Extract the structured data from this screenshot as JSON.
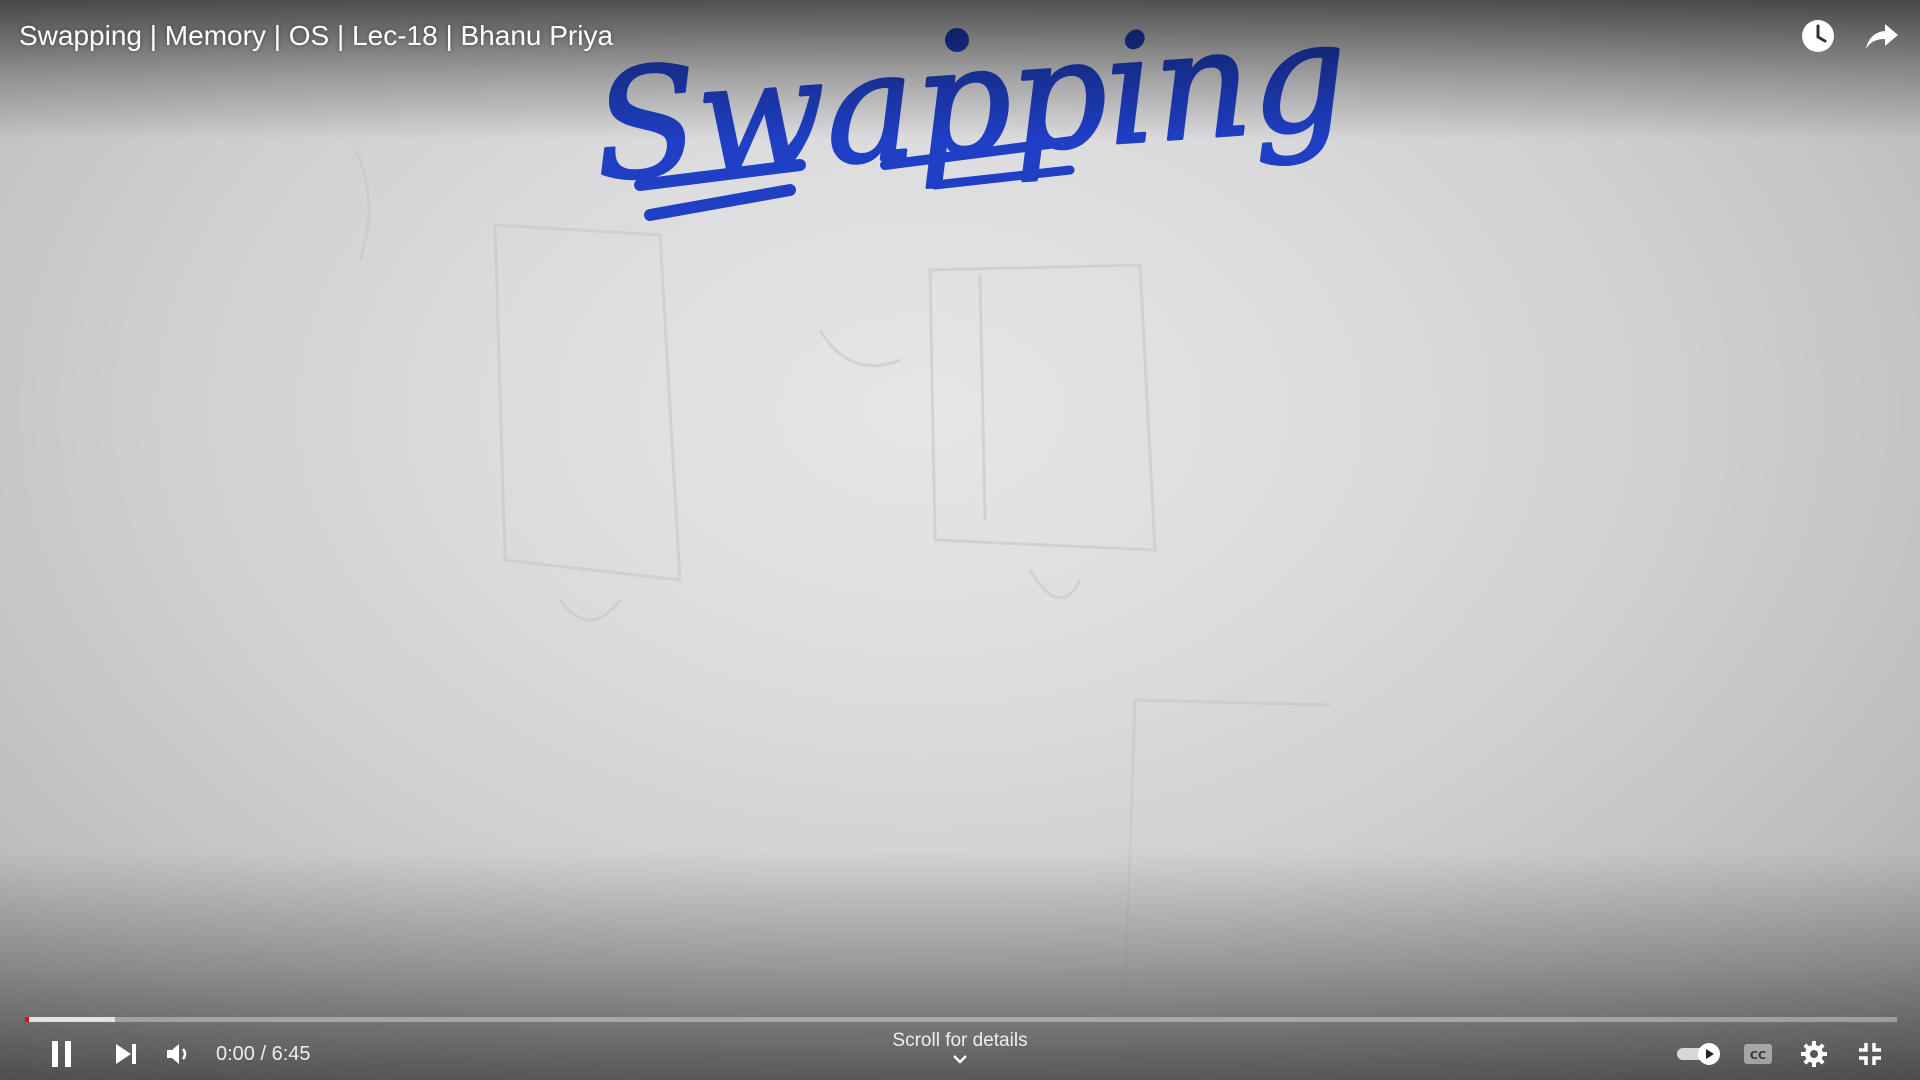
{
  "video": {
    "title": "Swapping | Memory | OS | Lec-18 | Bhanu Priya",
    "whiteboard_text": "Swapping",
    "current_time": "0:00",
    "duration": "6:45",
    "time_display": "0:00 / 6:45",
    "played_fraction": 0.002,
    "buffered_fraction": 0.048
  },
  "top_controls": {
    "watch_later_icon": "clock-icon",
    "share_icon": "share-arrow-icon"
  },
  "bottom_controls": {
    "play_pause_icon": "pause-icon",
    "next_icon": "next-icon",
    "volume_icon": "volume-icon",
    "autoplay_icon": "autoplay-toggle-icon",
    "captions_icon": "cc-icon",
    "settings_icon": "gear-icon",
    "fullscreen_icon": "exit-fullscreen-icon"
  },
  "scroll_hint": {
    "label": "Scroll for details"
  },
  "colors": {
    "progress_played": "#ff0000",
    "marker_ink": "#1f3fc4"
  }
}
